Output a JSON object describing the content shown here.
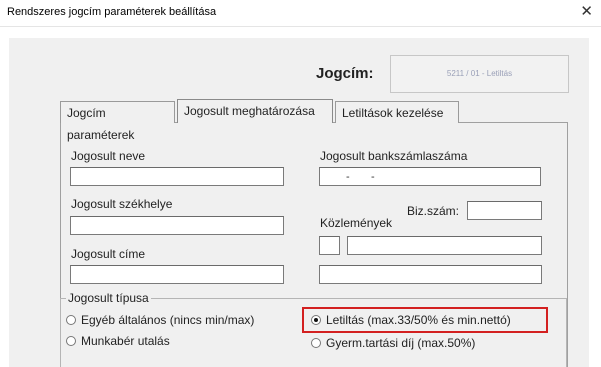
{
  "window": {
    "title": "Rendszeres jogcím paraméterek beállítása",
    "close_symbol": "✕"
  },
  "jogcim": {
    "label": "Jogcím:",
    "value": "5211 / 01 - Letiltás"
  },
  "tabs": [
    {
      "label": "Jogcím paraméterek"
    },
    {
      "label": "Jogosult meghatározása"
    },
    {
      "label": "Letiltások kezelése"
    }
  ],
  "form": {
    "jogosult_neve": {
      "label": "Jogosult neve",
      "value": ""
    },
    "jogosult_szekhelye": {
      "label": "Jogosult székhelye",
      "value": ""
    },
    "jogosult_cime": {
      "label": "Jogosult címe",
      "value": ""
    },
    "bankszamla": {
      "label": "Jogosult bankszámlaszáma",
      "value": "-       -"
    },
    "biz_szam": {
      "label": "Biz.szám:",
      "value": ""
    },
    "kozlemenyek": {
      "label": "Közlemények",
      "value_short": "",
      "value_long": "",
      "value_line2": ""
    }
  },
  "jogosult_tipusa": {
    "legend": "Jogosult típusa",
    "options": [
      {
        "label": "Egyéb általános (nincs min/max)",
        "checked": false
      },
      {
        "label": "Letiltás (max.33/50% és min.nettó)",
        "checked": true
      },
      {
        "label": "Munkabér utalás",
        "checked": false
      },
      {
        "label": "Gyerm.tartási díj (max.50%)",
        "checked": false
      }
    ]
  },
  "colors": {
    "highlight": "#d32020",
    "panel_bg": "#f0f0f0"
  }
}
